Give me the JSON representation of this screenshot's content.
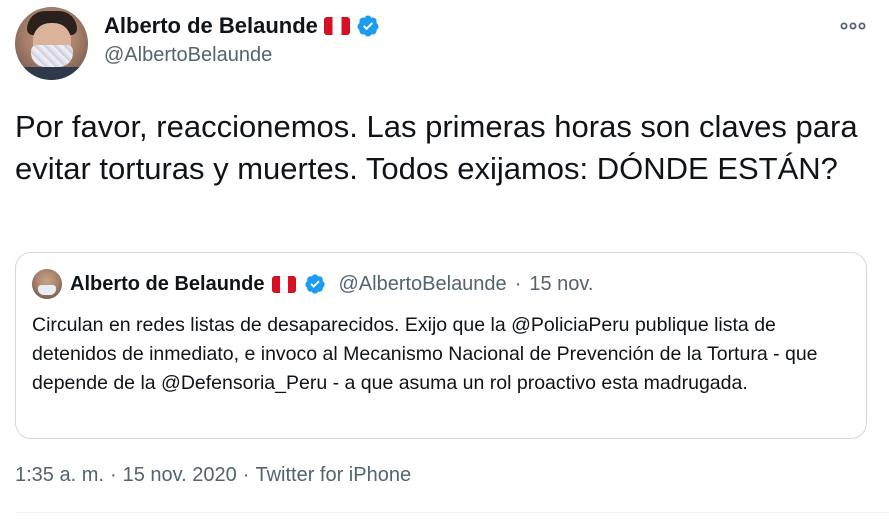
{
  "author": {
    "name": "Alberto de Belaunde",
    "handle": "@AlbertoBelaunde"
  },
  "tweet": {
    "text": "Por favor, reaccionemos. Las primeras horas son claves para evitar torturas y muertes. Todos exijamos: DÓNDE ESTÁN?"
  },
  "quoted_tweet": {
    "name": "Alberto de Belaunde",
    "handle": "@AlbertoBelaunde",
    "separator": "·",
    "date": "15 nov.",
    "text": "Circulan en redes listas de desaparecidos. Exijo que la @PoliciaPeru publique lista de detenidos de inmediato, e invoco al Mecanismo Nacional de Prevención de la Tortura - que depende de la @Defensoria_Peru - a que asuma un rol proactivo esta madrugada."
  },
  "footer": {
    "time": "1:35 a. m.",
    "sep1": "·",
    "date": "15 nov. 2020",
    "sep2": "·",
    "source": "Twitter for iPhone"
  },
  "icons": {
    "verified": "verified-badge-icon",
    "flag": "peru-flag-icon",
    "more": "more-options-icon"
  },
  "colors": {
    "verified": "#1d9bf0",
    "secondary_text": "#536471",
    "border": "#cfd9de",
    "flag_red": "#d91023"
  }
}
